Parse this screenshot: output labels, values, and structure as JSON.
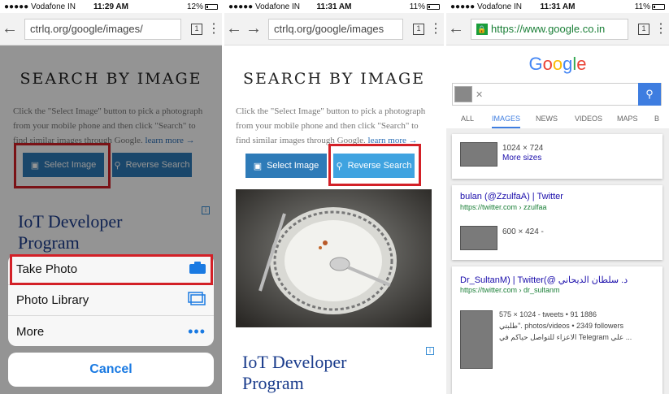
{
  "panel1": {
    "status": {
      "carrier": "●●●●● Vodafone IN",
      "time": "11:29 AM",
      "battery": "12%"
    },
    "url": "ctrlq.org/google/images/",
    "tab_count": "1",
    "page_title": "SEARCH BY IMAGE",
    "intro_text": "Click the \"Select Image\" button to pick a photograph from your mobile phone and then click \"Search\" to find similar images through Google.",
    "learn_more": "learn more →",
    "select_image_label": "Select Image",
    "reverse_search_label": "Reverse Search",
    "ad_line1": "IoT Developer",
    "ad_line2": "Program",
    "sheet": {
      "take_photo": "Take Photo",
      "photo_library": "Photo Library",
      "more": "More",
      "cancel": "Cancel"
    }
  },
  "panel2": {
    "status": {
      "carrier": "●●●●● Vodafone IN",
      "time": "11:31 AM",
      "battery": "11%"
    },
    "url": "ctrlq.org/google/images",
    "tab_count": "1",
    "page_title": "SEARCH BY IMAGE",
    "intro_text": "Click the \"Select Image\" button to pick a photograph from your mobile phone and then click \"Search\" to find similar images through Google.",
    "learn_more": "learn more →",
    "select_image_label": "Select Image",
    "reverse_search_label": "Reverse Search",
    "ad_line1": "IoT Developer",
    "ad_line2": "Program"
  },
  "panel3": {
    "status": {
      "carrier": "●●●●● Vodafone IN",
      "time": "11:31 AM",
      "battery": "11%"
    },
    "url": "https://www.google.co.in",
    "tab_count": "1",
    "google_logo": "Google",
    "tabs": [
      "ALL",
      "IMAGES",
      "NEWS",
      "VIDEOS",
      "MAPS",
      "B"
    ],
    "active_tab": "IMAGES",
    "result1": {
      "size": "1024 × 724",
      "more_sizes": "More sizes"
    },
    "result2": {
      "title": "bulan (@ZzulfaA) | Twitter",
      "url": "https://twitter.com › zzulfaa",
      "size": "600 × 424 -"
    },
    "result3": {
      "title": "Dr_SultanM) | Twitter(@ د. سلطان الديحاني",
      "url": "https://twitter.com › dr_sultanm",
      "meta_line1": "575 × 1024 - tweets • 91 1886",
      "meta_line2": "طلبتي\". photos/videos • 2349 followers",
      "meta_line3": "الاعزاء للتواصل حياكم في Telegram علي ..."
    }
  },
  "colors": {
    "highlight_red": "#d32027",
    "button_blue": "#2e7bb8",
    "button_light_blue": "#3fa3e0",
    "ios_blue": "#1a7ae2",
    "google_blue": "#3e7de0"
  }
}
